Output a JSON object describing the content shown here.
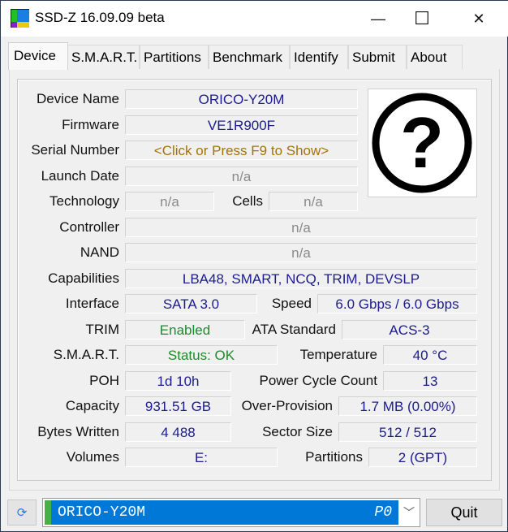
{
  "window": {
    "title": "SSD-Z 16.09.09 beta",
    "minimize": "—",
    "maximize": "☐",
    "close": "✕"
  },
  "tabs": [
    "Device",
    "S.M.A.R.T.",
    "Partitions",
    "Benchmark",
    "Identify",
    "Submit",
    "About"
  ],
  "fields": {
    "device_name": {
      "label": "Device Name",
      "value": "ORICO-Y20M"
    },
    "firmware": {
      "label": "Firmware",
      "value": "VE1R900F"
    },
    "serial": {
      "label": "Serial Number",
      "value": "<Click or Press F9 to Show>"
    },
    "launch_date": {
      "label": "Launch Date",
      "value": "n/a"
    },
    "technology": {
      "label": "Technology",
      "value": "n/a"
    },
    "cells": {
      "label": "Cells",
      "value": "n/a"
    },
    "controller": {
      "label": "Controller",
      "value": "n/a"
    },
    "nand": {
      "label": "NAND",
      "value": "n/a"
    },
    "capabilities": {
      "label": "Capabilities",
      "value": "LBA48, SMART, NCQ, TRIM, DEVSLP"
    },
    "interface": {
      "label": "Interface",
      "value": "SATA 3.0"
    },
    "speed": {
      "label": "Speed",
      "value": "6.0 Gbps / 6.0 Gbps"
    },
    "trim": {
      "label": "TRIM",
      "value": "Enabled"
    },
    "ata_standard": {
      "label": "ATA Standard",
      "value": "ACS-3"
    },
    "smart": {
      "label": "S.M.A.R.T.",
      "value": "Status: OK"
    },
    "temperature": {
      "label": "Temperature",
      "value": "40 °C"
    },
    "poh": {
      "label": "POH",
      "value": "1d 10h"
    },
    "power_cycle_count": {
      "label": "Power Cycle Count",
      "value": "13"
    },
    "capacity": {
      "label": "Capacity",
      "value": "931.51 GB"
    },
    "over_provision": {
      "label": "Over-Provision",
      "value": "1.7 MB (0.00%)"
    },
    "bytes_written": {
      "label": "Bytes Written",
      "value": "4 488"
    },
    "sector_size": {
      "label": "Sector Size",
      "value": "512 / 512"
    },
    "volumes": {
      "label": "Volumes",
      "value": "E:"
    },
    "partitions": {
      "label": "Partitions",
      "value": "2 (GPT)"
    }
  },
  "bottom": {
    "drive_name": "ORICO-Y20M",
    "drive_port": "P0",
    "quit": "Quit"
  }
}
